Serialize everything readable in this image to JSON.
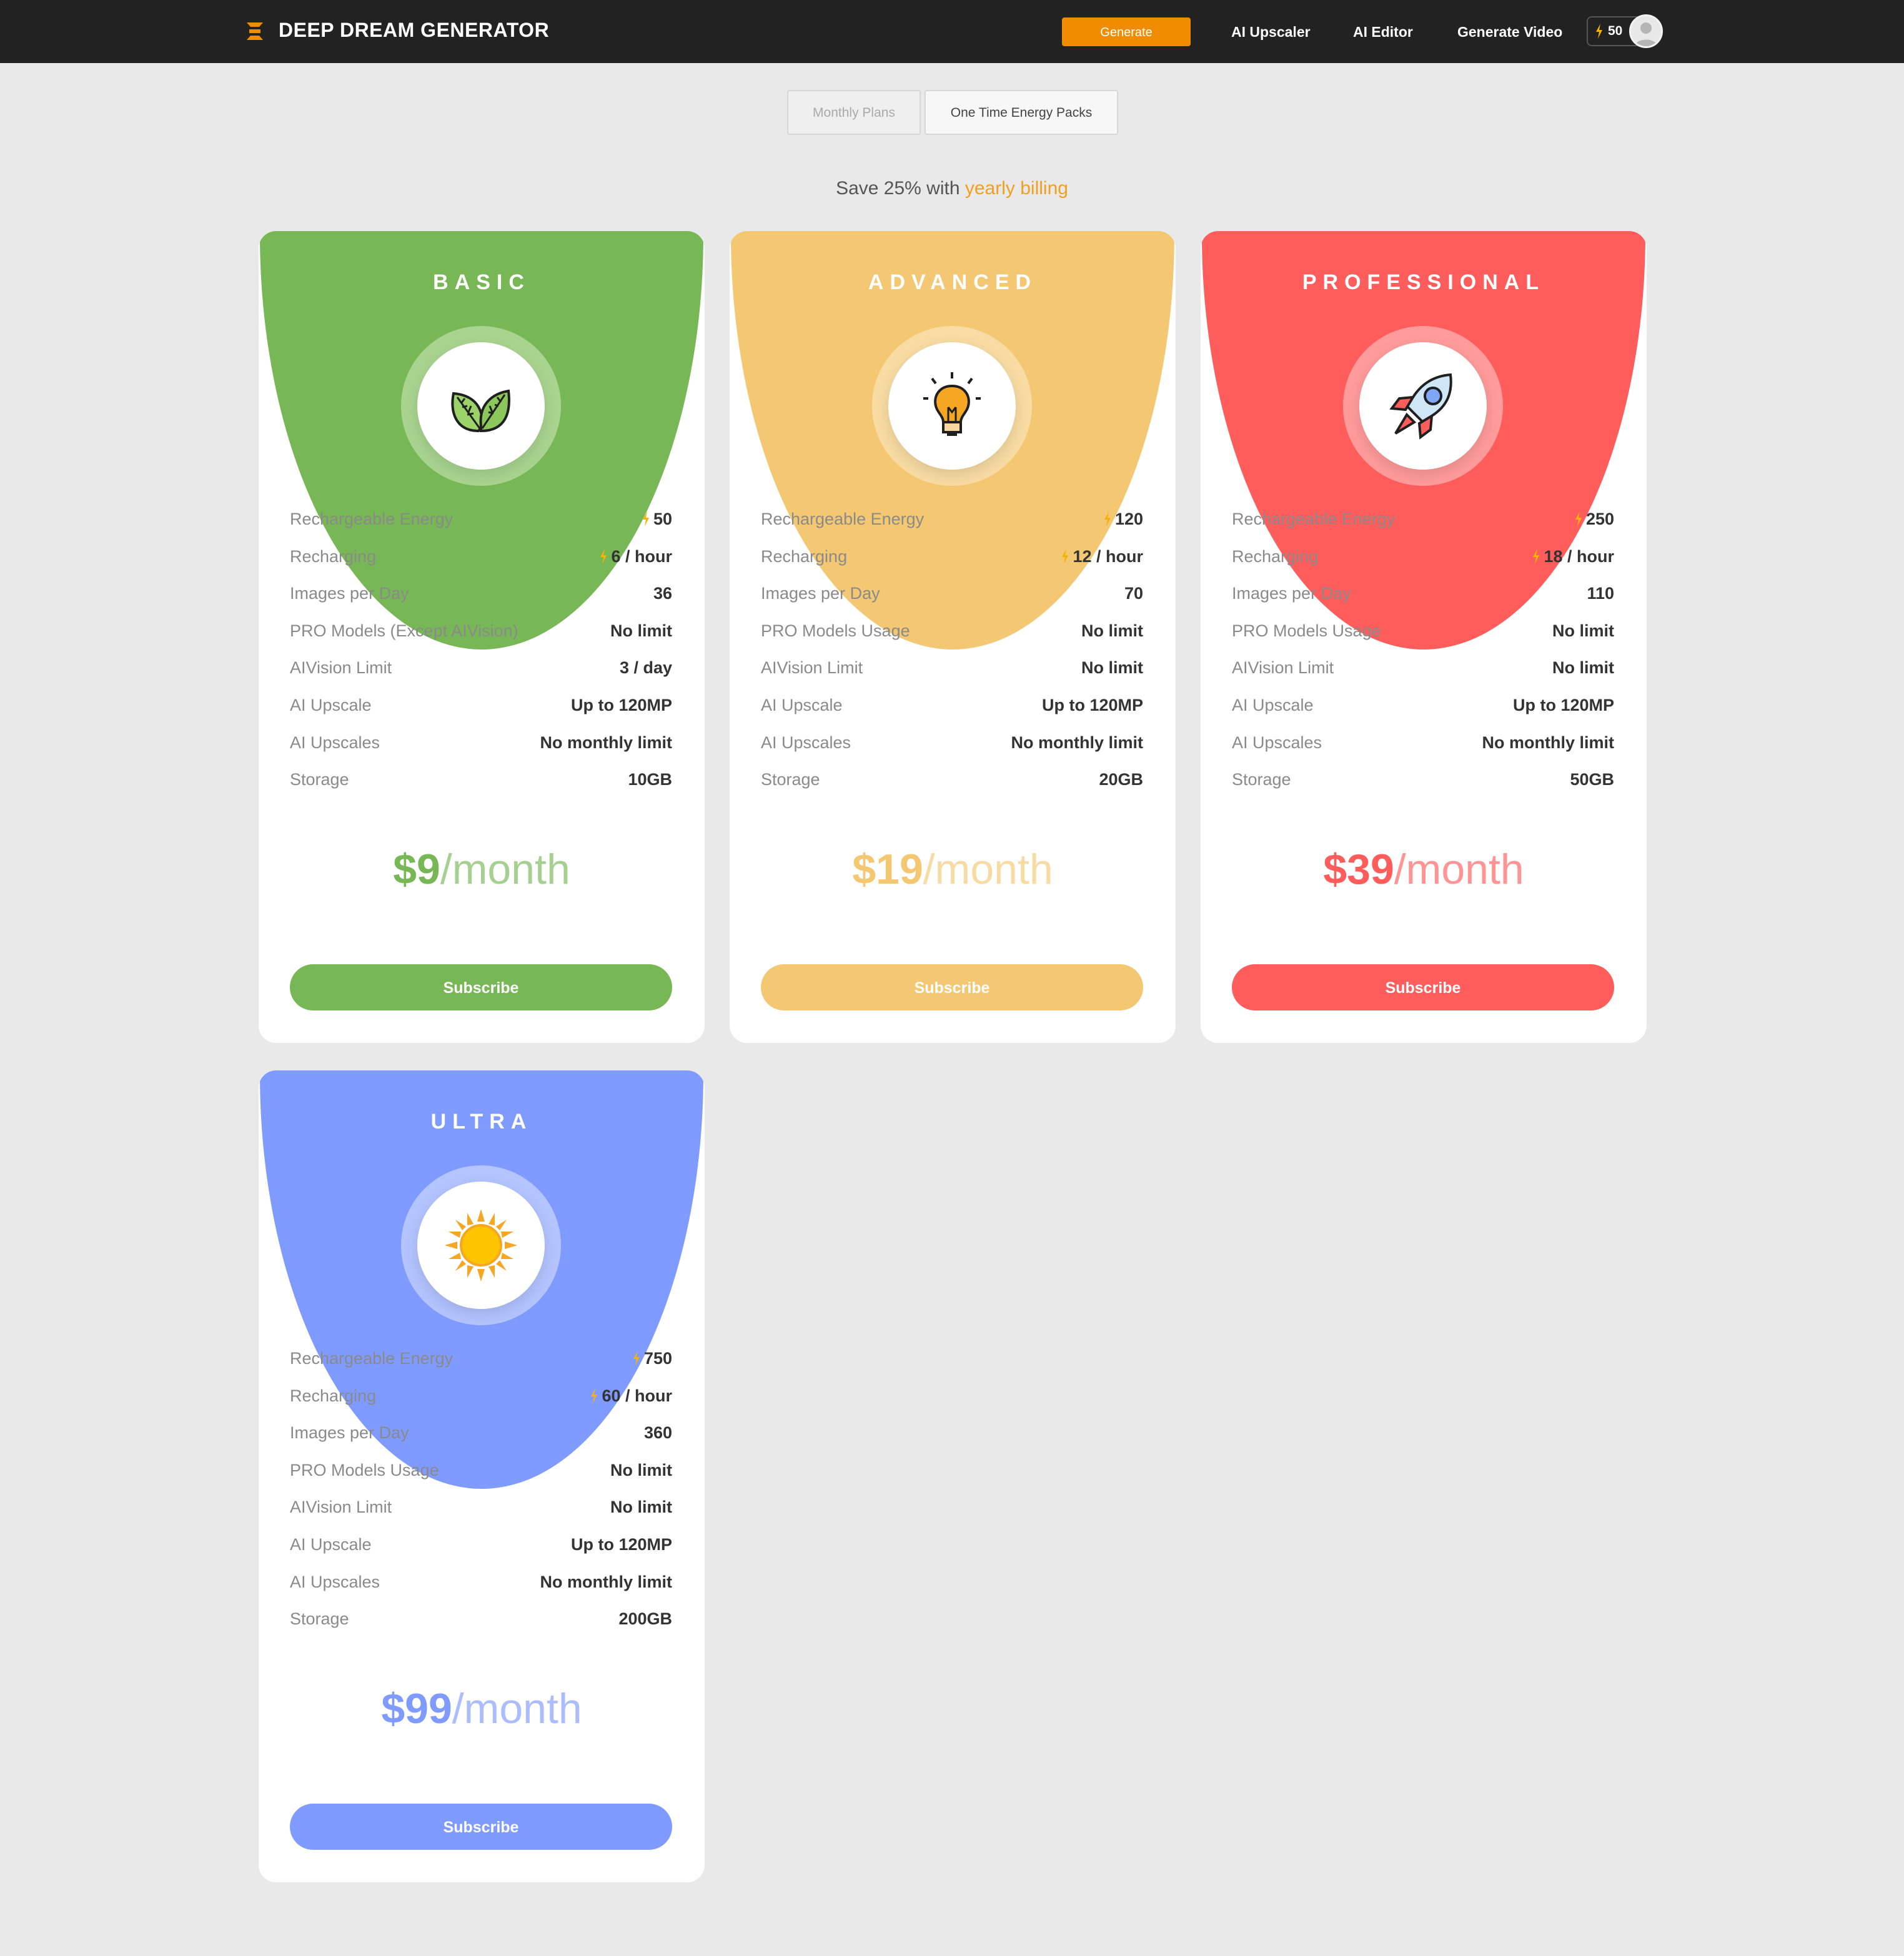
{
  "app": {
    "brand": "DEEP DREAM GENERATOR",
    "nav": {
      "generate": "Generate",
      "upscaler": "AI Upscaler",
      "editor": "AI Editor",
      "video": "Generate Video",
      "energy": "50"
    }
  },
  "tabs": {
    "monthly": "Monthly Plans",
    "packs": "One Time Energy Packs"
  },
  "save": {
    "prefix": "Save 25% with",
    "highlight": "yearly billing"
  },
  "colors": {
    "accent": "#f08c00",
    "basic": "#78b755",
    "advanced": "#f4c873",
    "professional": "#ff5c5c",
    "ultra": "#809bff",
    "bolt": "#f4b400"
  },
  "plans": [
    {
      "name": "BASIC",
      "icon": "leaf-icon",
      "rows": [
        {
          "label": "Rechargeable Energy",
          "value": "50",
          "bolt": true
        },
        {
          "label": "Recharging",
          "value": "6 / hour",
          "bolt": true
        },
        {
          "label": "Images per Day",
          "value": "36"
        },
        {
          "label": "PRO Models (Except AIVision)",
          "value": "No limit"
        },
        {
          "label": "AIVision Limit",
          "value": "3 / day"
        },
        {
          "label": "AI Upscale",
          "value": "Up to 120MP"
        },
        {
          "label": "AI Upscales",
          "value": "No monthly limit"
        },
        {
          "label": "Storage",
          "value": "10GB"
        }
      ],
      "price": "$9",
      "period": "/month",
      "cta": "Subscribe"
    },
    {
      "name": "ADVANCED",
      "icon": "lightbulb-icon",
      "rows": [
        {
          "label": "Rechargeable Energy",
          "value": "120",
          "bolt": true
        },
        {
          "label": "Recharging",
          "value": "12 / hour",
          "bolt": true
        },
        {
          "label": "Images per Day",
          "value": "70"
        },
        {
          "label": "PRO Models Usage",
          "value": "No limit"
        },
        {
          "label": "AIVision Limit",
          "value": "No limit"
        },
        {
          "label": "AI Upscale",
          "value": "Up to 120MP"
        },
        {
          "label": "AI Upscales",
          "value": "No monthly limit"
        },
        {
          "label": "Storage",
          "value": "20GB"
        }
      ],
      "price": "$19",
      "period": "/month",
      "cta": "Subscribe"
    },
    {
      "name": "PROFESSIONAL",
      "icon": "rocket-icon",
      "rows": [
        {
          "label": "Rechargeable Energy",
          "value": "250",
          "bolt": true
        },
        {
          "label": "Recharging",
          "value": "18 / hour",
          "bolt": true
        },
        {
          "label": "Images per Day",
          "value": "110"
        },
        {
          "label": "PRO Models Usage",
          "value": "No limit"
        },
        {
          "label": "AIVision Limit",
          "value": "No limit"
        },
        {
          "label": "AI Upscale",
          "value": "Up to 120MP"
        },
        {
          "label": "AI Upscales",
          "value": "No monthly limit"
        },
        {
          "label": "Storage",
          "value": "50GB"
        }
      ],
      "price": "$39",
      "period": "/month",
      "cta": "Subscribe"
    },
    {
      "name": "ULTRA",
      "icon": "sun-icon",
      "rows": [
        {
          "label": "Rechargeable Energy",
          "value": "750",
          "bolt": true
        },
        {
          "label": "Recharging",
          "value": "60 / hour",
          "bolt": true
        },
        {
          "label": "Images per Day",
          "value": "360"
        },
        {
          "label": "PRO Models Usage",
          "value": "No limit"
        },
        {
          "label": "AIVision Limit",
          "value": "No limit"
        },
        {
          "label": "AI Upscale",
          "value": "Up to 120MP"
        },
        {
          "label": "AI Upscales",
          "value": "No monthly limit"
        },
        {
          "label": "Storage",
          "value": "200GB"
        }
      ],
      "price": "$99",
      "period": "/month",
      "cta": "Subscribe"
    }
  ]
}
